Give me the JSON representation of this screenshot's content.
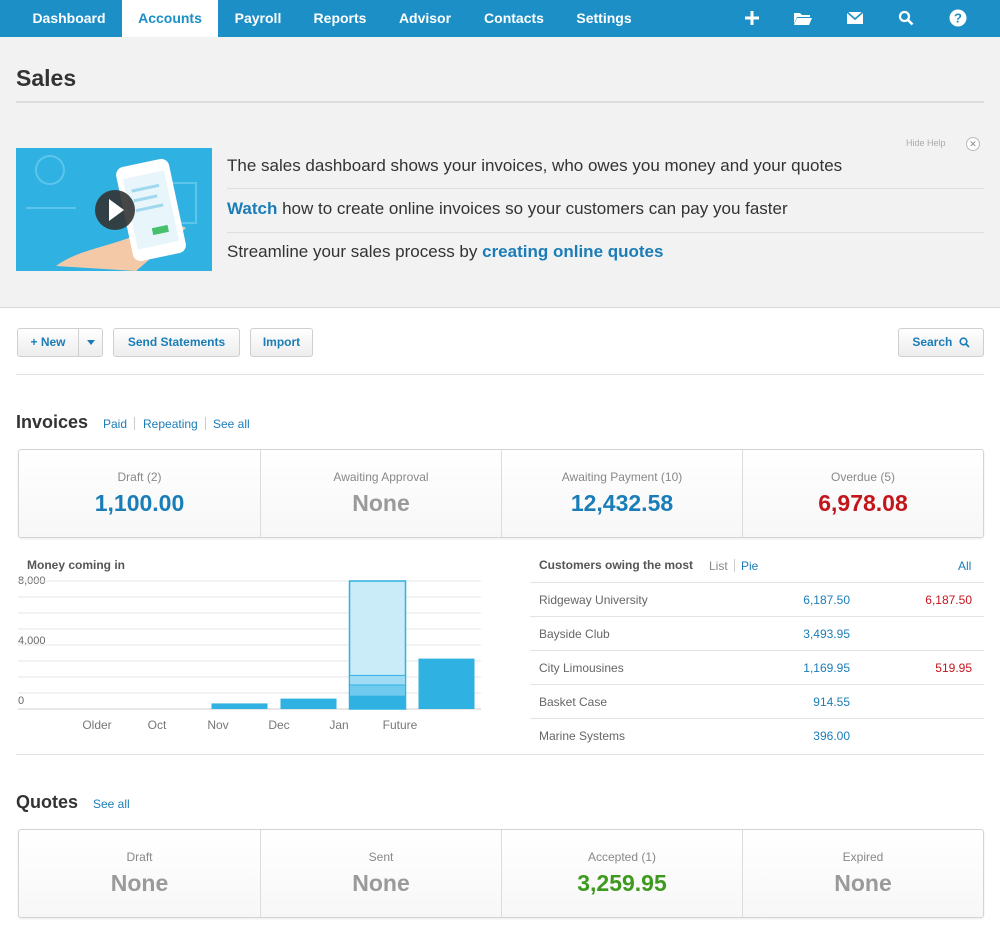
{
  "nav": {
    "tabs": [
      {
        "label": "Dashboard",
        "active": false
      },
      {
        "label": "Accounts",
        "active": true
      },
      {
        "label": "Payroll",
        "active": false
      },
      {
        "label": "Reports",
        "active": false
      },
      {
        "label": "Advisor",
        "active": false
      },
      {
        "label": "Contacts",
        "active": false
      },
      {
        "label": "Settings",
        "active": false
      }
    ],
    "icons": [
      "plus-icon",
      "folder-icon",
      "mail-icon",
      "search-icon",
      "help-icon"
    ]
  },
  "page": {
    "title": "Sales"
  },
  "help": {
    "hide_label": "Hide Help",
    "line1": "The sales dashboard shows your invoices, who owes you money and your quotes",
    "line2_link": "Watch",
    "line2_rest": " how to create online invoices so your customers can pay you faster",
    "line3_text": "Streamline your sales process by ",
    "line3_link": "creating online quotes"
  },
  "toolbar": {
    "new_label": "+ New",
    "send_statements_label": "Send Statements",
    "import_label": "Import",
    "search_label": "Search"
  },
  "invoices": {
    "title": "Invoices",
    "links": [
      "Paid",
      "Repeating",
      "See all"
    ],
    "stats": [
      {
        "label": "Draft (2)",
        "value": "1,100.00",
        "tone": "blue"
      },
      {
        "label": "Awaiting Approval",
        "value": "None",
        "tone": "grey"
      },
      {
        "label": "Awaiting Payment (10)",
        "value": "12,432.58",
        "tone": "blue"
      },
      {
        "label": "Overdue (5)",
        "value": "6,978.08",
        "tone": "red"
      }
    ]
  },
  "chart_data": {
    "type": "bar",
    "title": "Money coming in",
    "categories": [
      "Older",
      "Oct",
      "Nov",
      "Dec",
      "Jan",
      "Future"
    ],
    "values": [
      0,
      0,
      350,
      650,
      8000,
      3150
    ],
    "y_ticks": [
      "8,000",
      "4,000",
      "0"
    ],
    "ylim": [
      0,
      8000
    ],
    "jan_segments": [
      800,
      700,
      600
    ],
    "grid": true,
    "colors": {
      "bar": "#2fb1e2",
      "light": "#c9ecf8"
    }
  },
  "customers": {
    "title": "Customers owing the most",
    "view_links": [
      "List",
      "Pie"
    ],
    "all_link": "All",
    "rows": [
      {
        "name": "Ridgeway University",
        "amount": "6,187.50",
        "overdue": "6,187.50"
      },
      {
        "name": "Bayside Club",
        "amount": "3,493.95",
        "overdue": ""
      },
      {
        "name": "City Limousines",
        "amount": "1,169.95",
        "overdue": "519.95"
      },
      {
        "name": "Basket Case",
        "amount": "914.55",
        "overdue": ""
      },
      {
        "name": "Marine Systems",
        "amount": "396.00",
        "overdue": ""
      }
    ]
  },
  "quotes": {
    "title": "Quotes",
    "link": "See all",
    "stats": [
      {
        "label": "Draft",
        "value": "None",
        "tone": "grey"
      },
      {
        "label": "Sent",
        "value": "None",
        "tone": "grey"
      },
      {
        "label": "Accepted (1)",
        "value": "3,259.95",
        "tone": "green"
      },
      {
        "label": "Expired",
        "value": "None",
        "tone": "grey"
      }
    ]
  }
}
